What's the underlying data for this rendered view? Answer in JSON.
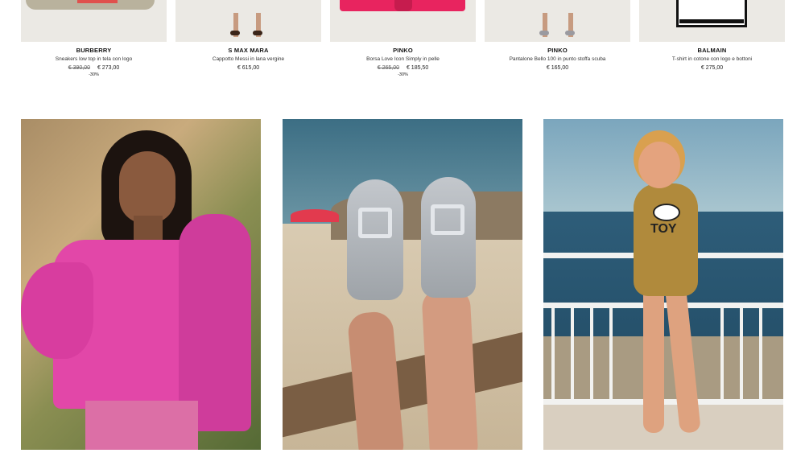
{
  "products": [
    {
      "brand": "BURBERRY",
      "description": "Sneakers low top in tela con logo",
      "old_price": "€ 390,00",
      "price": "€ 273,00",
      "discount": "-30%"
    },
    {
      "brand": "S MAX MARA",
      "description": "Cappotto Messi in lana vergine",
      "old_price": "",
      "price": "€ 615,00",
      "discount": ""
    },
    {
      "brand": "PINKO",
      "description": "Borsa Love Icon Simply in pelle",
      "old_price": "€ 265,00",
      "price": "€ 185,50",
      "discount": "-30%"
    },
    {
      "brand": "PINKO",
      "description": "Pantalone Bello 100 in punto stoffa scuba",
      "old_price": "",
      "price": "€ 165,00",
      "discount": ""
    },
    {
      "brand": "BALMAIN",
      "description": "T-shirt in cotone con logo e bottoni",
      "old_price": "",
      "price": "€ 275,00",
      "discount": ""
    }
  ],
  "editorial": {
    "image3_print": "TOY"
  },
  "colors": {
    "bag_pink": "#e8245f",
    "blouse_magenta": "#e247a8",
    "sea_blue": "#2e5d79"
  }
}
